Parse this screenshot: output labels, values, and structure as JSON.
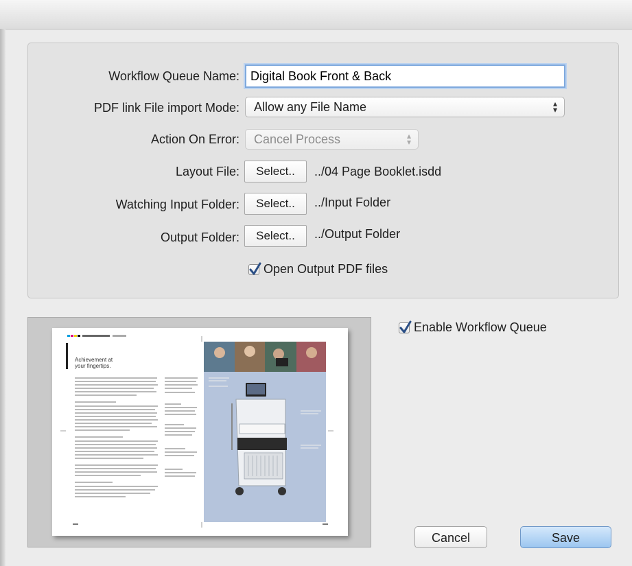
{
  "form": {
    "queue_name_label": "Workflow Queue Name:",
    "queue_name_value": "Digital Book Front & Back",
    "import_mode_label": "PDF link File import Mode:",
    "import_mode_value": "Allow any File Name",
    "action_on_error_label": "Action On Error:",
    "action_on_error_value": "Cancel Process",
    "layout_file_label": "Layout File:",
    "layout_file_button": "Select..",
    "layout_file_path": "../04 Page Booklet.isdd",
    "input_folder_label": "Watching Input Folder:",
    "input_folder_button": "Select..",
    "input_folder_path": "../Input Folder",
    "output_folder_label": "Output Folder:",
    "output_folder_button": "Select..",
    "output_folder_path": "../Output Folder",
    "open_output_label": "Open Output PDF files",
    "open_output_checked": true
  },
  "enable_queue": {
    "label": "Enable Workflow Queue",
    "checked": true
  },
  "preview": {
    "heading_line1": "Achievement at",
    "heading_line2": "your fingertips."
  },
  "buttons": {
    "cancel": "Cancel",
    "save": "Save"
  },
  "colors": {
    "accent": "#7fa9dd",
    "checkmark": "#2b4f86",
    "preview_panel": "#b5c4dc"
  }
}
